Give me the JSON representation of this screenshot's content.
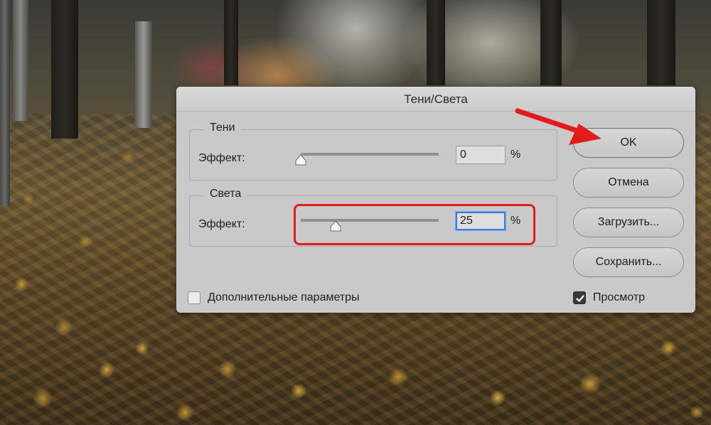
{
  "dialog": {
    "title": "Тени/Света",
    "shadows": {
      "legend": "Тени",
      "effect_label": "Эффект:",
      "amount_value": "0",
      "amount": 0,
      "unit": "%"
    },
    "highlights": {
      "legend": "Света",
      "effect_label": "Эффект:",
      "amount_value": "25",
      "amount": 25,
      "unit": "%"
    },
    "buttons": {
      "ok": "OK",
      "cancel": "Отмена",
      "load": "Загрузить...",
      "save": "Сохранить..."
    },
    "more_options": {
      "label": "Дополнительные параметры",
      "checked": false
    },
    "preview": {
      "label": "Просмотр",
      "checked": true
    }
  },
  "annotations": {
    "color": "#e31b1b"
  },
  "icons": [
    "slider-thumb-icon",
    "checkmark-icon",
    "red-arrow-icon"
  ]
}
